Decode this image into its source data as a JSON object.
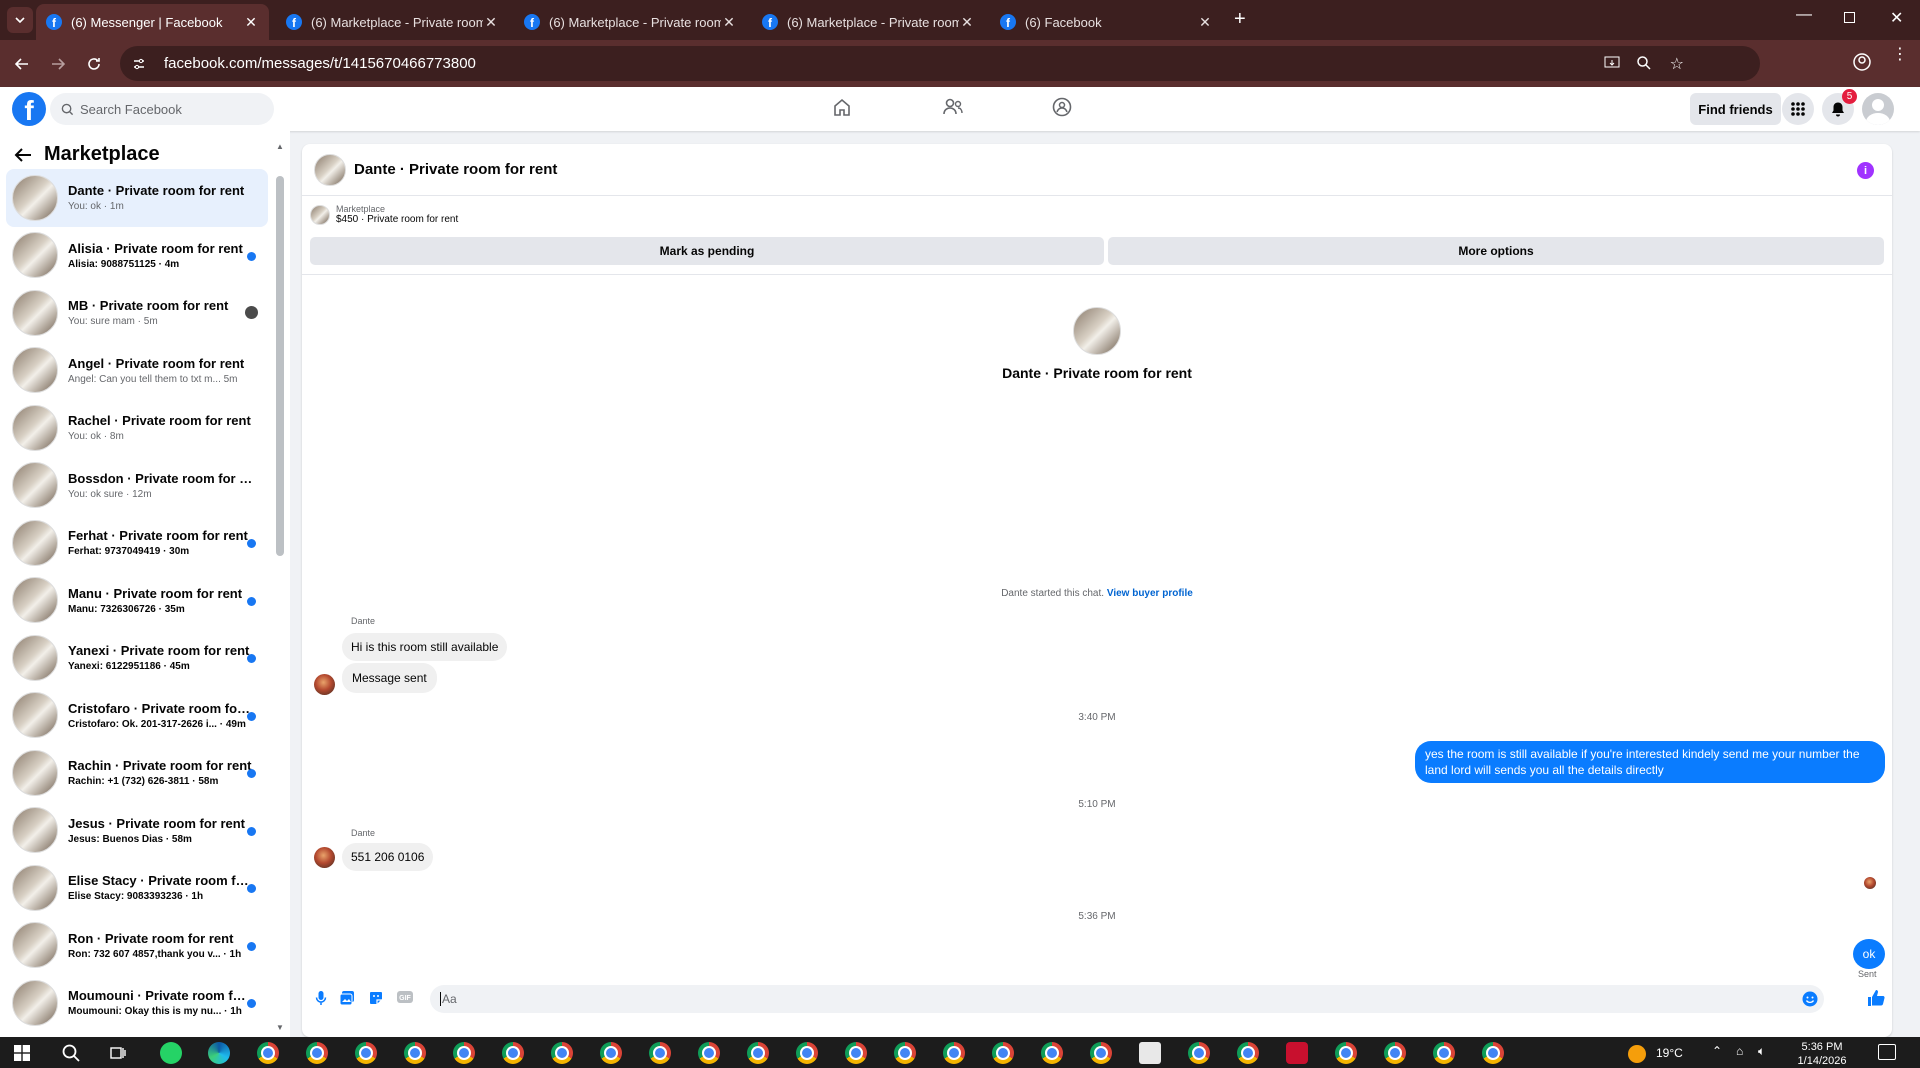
{
  "browser": {
    "tabs": [
      {
        "title": "(6) Messenger | Facebook",
        "active": true
      },
      {
        "title": "(6) Marketplace - Private room",
        "active": false
      },
      {
        "title": "(6) Marketplace - Private room",
        "active": false
      },
      {
        "title": "(6) Marketplace - Private room",
        "active": false
      },
      {
        "title": "(6) Facebook",
        "active": false
      }
    ],
    "url": "facebook.com/messages/t/1415670466773800"
  },
  "header": {
    "search_placeholder": "Search Facebook",
    "find_friends_label": "Find friends",
    "notification_count": "5"
  },
  "sidebar": {
    "title": "Marketplace",
    "conversations": [
      {
        "name": "Dante · Private room for rent",
        "preview": "You: ok · 1m",
        "active": true,
        "status": "none"
      },
      {
        "name": "Alisia · Private room for rent",
        "preview": "Alisia: 9088751125 · 4m",
        "status": "unread"
      },
      {
        "name": "MB · Private room for rent",
        "preview": "You: sure mam · 5m",
        "status": "read"
      },
      {
        "name": "Angel · Private room for rent",
        "preview": "Angel: Can you tell them to txt m...   5m",
        "status": "none"
      },
      {
        "name": "Rachel · Private room for rent",
        "preview": "You: ok · 8m",
        "status": "none"
      },
      {
        "name": "Bossdon · Private room for rent",
        "preview": "You: ok sure · 12m",
        "status": "none"
      },
      {
        "name": "Ferhat · Private room for rent",
        "preview": "Ferhat: 9737049419 · 30m",
        "status": "unread"
      },
      {
        "name": "Manu · Private room for rent",
        "preview": "Manu: 7326306726 · 35m",
        "status": "unread"
      },
      {
        "name": "Yanexi · Private room for rent",
        "preview": "Yanexi: 6122951186 · 45m",
        "status": "unread"
      },
      {
        "name": "Cristofaro · Private room for r...",
        "preview": "Cristofaro: Ok. 201-317-2626 i... · 49m",
        "status": "unread"
      },
      {
        "name": "Rachin · Private room for rent",
        "preview": "Rachin: +1 (732) 626-3811 · 58m",
        "status": "unread"
      },
      {
        "name": "Jesus · Private room for rent",
        "preview": "Jesus: Buenos Dias · 58m",
        "status": "unread"
      },
      {
        "name": "Elise Stacy · Private room for r...",
        "preview": "Elise Stacy: 9083393236 · 1h",
        "status": "unread"
      },
      {
        "name": "Ron · Private room for rent",
        "preview": "Ron: 732 607 4857,thank you v... · 1h",
        "status": "unread"
      },
      {
        "name": "Moumouni · Private room for ...",
        "preview": "Moumouni: Okay this is my nu... · 1h",
        "status": "unread"
      }
    ]
  },
  "chat": {
    "title": "Dante · Private room for rent",
    "marketplace_label": "Marketplace",
    "listing": "$450 · Private room for rent",
    "mark_pending_label": "Mark as pending",
    "more_options_label": "More options",
    "intro_title": "Dante · Private room for rent",
    "started_text": "Dante started this chat.",
    "view_profile_label": "View buyer profile",
    "sender_name": "Dante",
    "msg1": "Hi is this room still available",
    "msg2": "Message sent",
    "time1": "3:40 PM",
    "msg3": "yes the room is still available if you're interested kindely send me your number the land lord will sends you all the details directly",
    "time2": "5:10 PM",
    "sender_name2": "Dante",
    "msg4": "551 206 0106",
    "time3": "5:36 PM",
    "msg5": "ok",
    "sent_label": "Sent",
    "input_placeholder": "Aa"
  },
  "taskbar": {
    "temperature": "19°C",
    "time": "5:36 PM",
    "date": "1/14/2026"
  },
  "colors": {
    "accent": "#0a7cff",
    "brand": "#1877f2",
    "browser_frame": "#3c1f1f"
  }
}
